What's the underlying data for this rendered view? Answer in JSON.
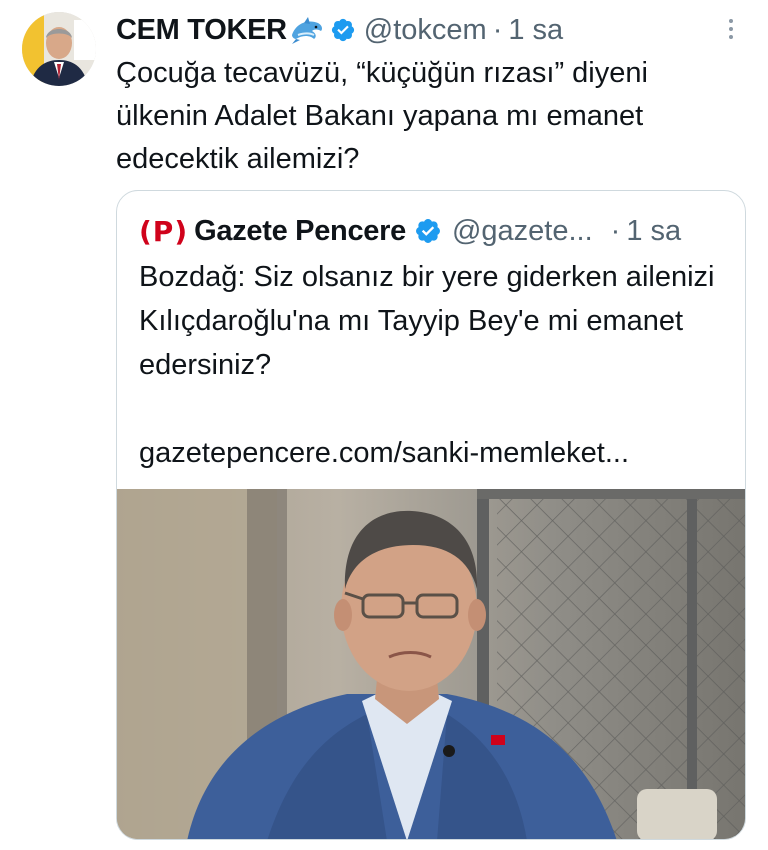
{
  "tweet": {
    "author_name": "CEM TOKER",
    "author_emoji": "dolphin-emoji",
    "handle": "@tokcem",
    "separator": "·",
    "time": "1 sa",
    "text": "Çocuğa tecavüzü, “küçüğün rızası” diyeni ülkenin Adalet Bakanı yapana mı emanet edecektik ailemizi?"
  },
  "quoted_tweet": {
    "logo_text": "(P)",
    "author_name": "Gazete Pencere",
    "handle": "@gazete...",
    "separator": "·",
    "time": "1 sa",
    "text": "Bozdağ: Siz olsanız bir yere giderken ailenizi Kılıçdaroğlu'na mı Tayyip Bey'e mi emanet edersiniz?",
    "link": "gazetepencere.com/sanki-memleket..."
  },
  "colors": {
    "verified_blue": "#1d9bf0",
    "secondary_text": "#536471",
    "border": "#cfd9de",
    "logo_red": "#d0021b"
  }
}
